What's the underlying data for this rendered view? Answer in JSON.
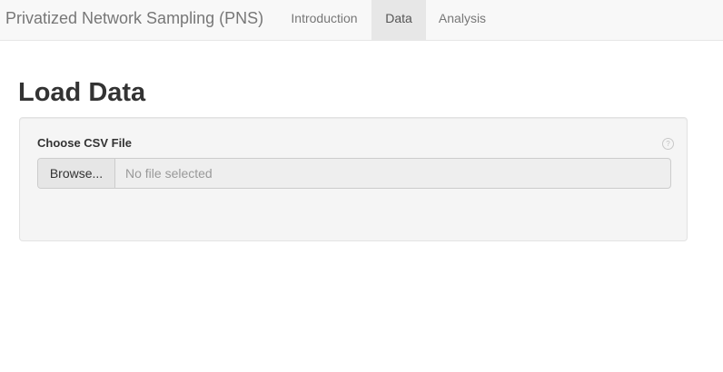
{
  "navbar": {
    "brand": "Privatized Network Sampling (PNS)",
    "tabs": [
      {
        "label": "Introduction",
        "active": false
      },
      {
        "label": "Data",
        "active": true
      },
      {
        "label": "Analysis",
        "active": false
      }
    ]
  },
  "page": {
    "title": "Load Data"
  },
  "file_input": {
    "label": "Choose CSV File",
    "button_label": "Browse...",
    "placeholder": "No file selected",
    "help_icon_text": "?"
  },
  "colors": {
    "navbar_bg": "#f8f8f8",
    "active_tab_bg": "#e7e7e7",
    "well_bg": "#f5f5f5"
  }
}
